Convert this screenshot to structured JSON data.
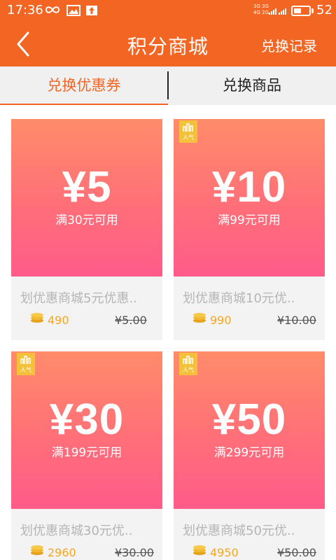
{
  "status_bar": {
    "time": "17:36",
    "network_top": "3G 3G",
    "network_bottom": "4G 2G",
    "battery_level": "52",
    "battery_fraction": 0.52
  },
  "header": {
    "title": "积分商城",
    "back_icon": "chevron-left-icon",
    "records_label": "兑换记录"
  },
  "tabs": [
    {
      "label": "兑换优惠券",
      "active": true
    },
    {
      "label": "兑换商品",
      "active": false
    }
  ],
  "colors": {
    "brand": "#f26522",
    "coupon_top": "#ff8c6a",
    "coupon_bottom": "#ff5b8a",
    "points": "#f5a623",
    "badge": "#f3c13a"
  },
  "coupons": [
    {
      "amount": "¥5",
      "condition": "满30元可用",
      "name": "划优惠商城5元优惠..",
      "points": "490",
      "original_price": "¥5.00",
      "hot": false,
      "hot_label": ""
    },
    {
      "amount": "¥10",
      "condition": "满99元可用",
      "name": "划优惠商城10元优..",
      "points": "990",
      "original_price": "¥10.00",
      "hot": true,
      "hot_label": "人气"
    },
    {
      "amount": "¥30",
      "condition": "满199元可用",
      "name": "划优惠商城30元优..",
      "points": "2960",
      "original_price": "¥30.00",
      "hot": true,
      "hot_label": "人气"
    },
    {
      "amount": "¥50",
      "condition": "满299元可用",
      "name": "划优惠商城50元优..",
      "points": "4950",
      "original_price": "¥50.00",
      "hot": true,
      "hot_label": "人气"
    }
  ]
}
